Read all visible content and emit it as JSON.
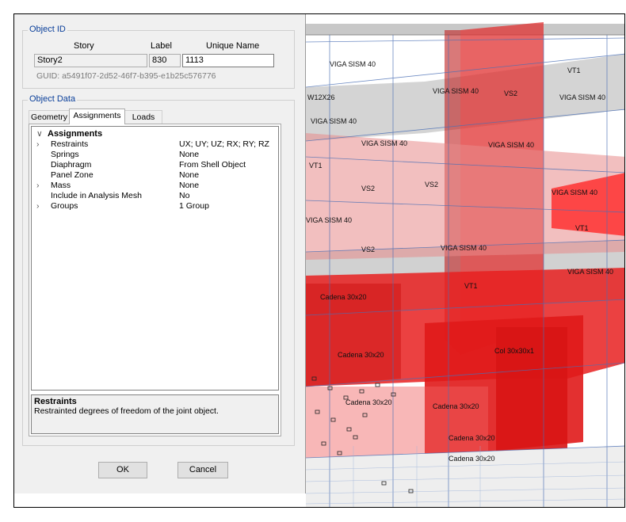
{
  "object_id": {
    "title": "Object ID",
    "headers": {
      "story": "Story",
      "label": "Label",
      "unique_name": "Unique Name"
    },
    "story": "Story2",
    "label": "830",
    "unique_name": "1113",
    "guid": "GUID:  a5491f07-2d52-46f7-b395-e1b25c576776"
  },
  "object_data": {
    "title": "Object Data",
    "tabs": [
      "Geometry",
      "Assignments",
      "Loads"
    ],
    "active_tab": "Assignments",
    "section_header": "Assignments",
    "rows": [
      {
        "name": "Restraints",
        "value": "UX; UY; UZ; RX; RY; RZ",
        "expandable": true
      },
      {
        "name": "Springs",
        "value": "None",
        "expandable": false
      },
      {
        "name": "Diaphragm",
        "value": "From Shell Object",
        "expandable": false
      },
      {
        "name": "Panel Zone",
        "value": "None",
        "expandable": false
      },
      {
        "name": "Mass",
        "value": "None",
        "expandable": true
      },
      {
        "name": "Include in Analysis Mesh",
        "value": "No",
        "expandable": false
      },
      {
        "name": "Groups",
        "value": "1 Group",
        "expandable": true
      }
    ],
    "description_title": "Restraints",
    "description_text": "Restrainted degrees of freedom of the joint object."
  },
  "buttons": {
    "ok": "OK",
    "cancel": "Cancel"
  },
  "viewport_labels": {
    "viga_sism_40": "VIGA SISM 40",
    "w12x26": "W12X26",
    "vt1": "VT1",
    "vs2": "VS2",
    "col": "Col 30x30x1",
    "cadena": "Cadena 30x20"
  },
  "colors": {
    "member_red": "#e82020",
    "group_title_blue": "#0a3f9a"
  }
}
